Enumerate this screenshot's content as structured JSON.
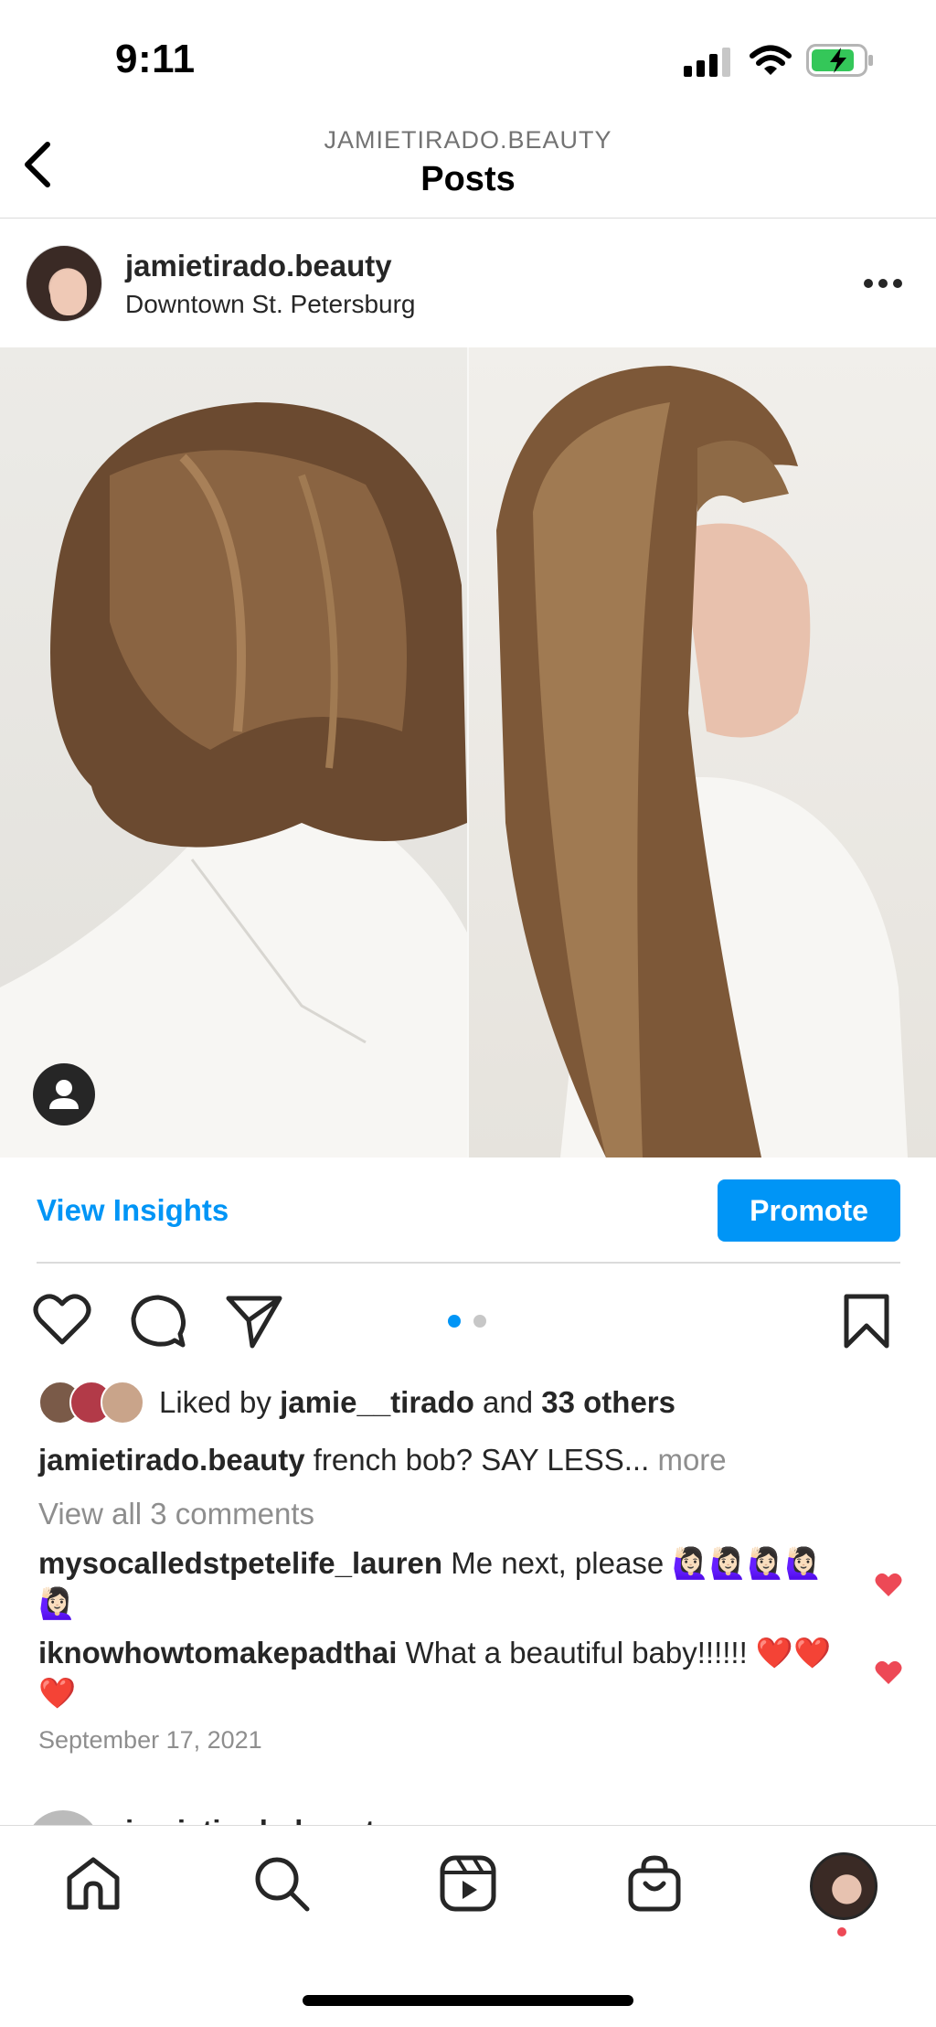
{
  "status_bar": {
    "time": "9:11"
  },
  "header": {
    "account": "JAMIETIRADO.BEAUTY",
    "title": "Posts"
  },
  "post": {
    "username": "jamietirado.beauty",
    "location": "Downtown St. Petersburg",
    "carousel": {
      "current": 1,
      "total": 2
    },
    "insights_label": "View Insights",
    "promote_label": "Promote",
    "likes": {
      "prefix": "Liked by ",
      "user": "jamie__tirado",
      "and": " and ",
      "others": "33 others"
    },
    "caption": {
      "user": "jamietirado.beauty",
      "text": " french bob? SAY LESS...",
      "more": " more"
    },
    "view_all_comments": "View all 3 comments",
    "comments": [
      {
        "user": "mysocalledstpetelife_lauren",
        "text": " Me next, please 🙋🏻‍♀️🙋🏻‍♀️🙋🏻‍♀️🙋🏻‍♀️🙋🏻‍♀️"
      },
      {
        "user": "iknowhowtomakepadthai",
        "text": " What a beautiful baby!!!!!! ❤️❤️❤️"
      }
    ],
    "date": "September 17, 2021"
  },
  "next_post": {
    "username": "jamietirado.beauty"
  },
  "colors": {
    "accent": "#0095f6",
    "heart": "#ed4956",
    "text": "#262626",
    "muted": "#8e8e8e"
  },
  "icons": [
    "signal-icon",
    "wifi-icon",
    "battery-icon",
    "back-icon",
    "more-icon",
    "user-tag-icon",
    "heart-icon",
    "comment-icon",
    "share-icon",
    "bookmark-icon",
    "home-icon",
    "search-icon",
    "reels-icon",
    "shop-icon"
  ]
}
